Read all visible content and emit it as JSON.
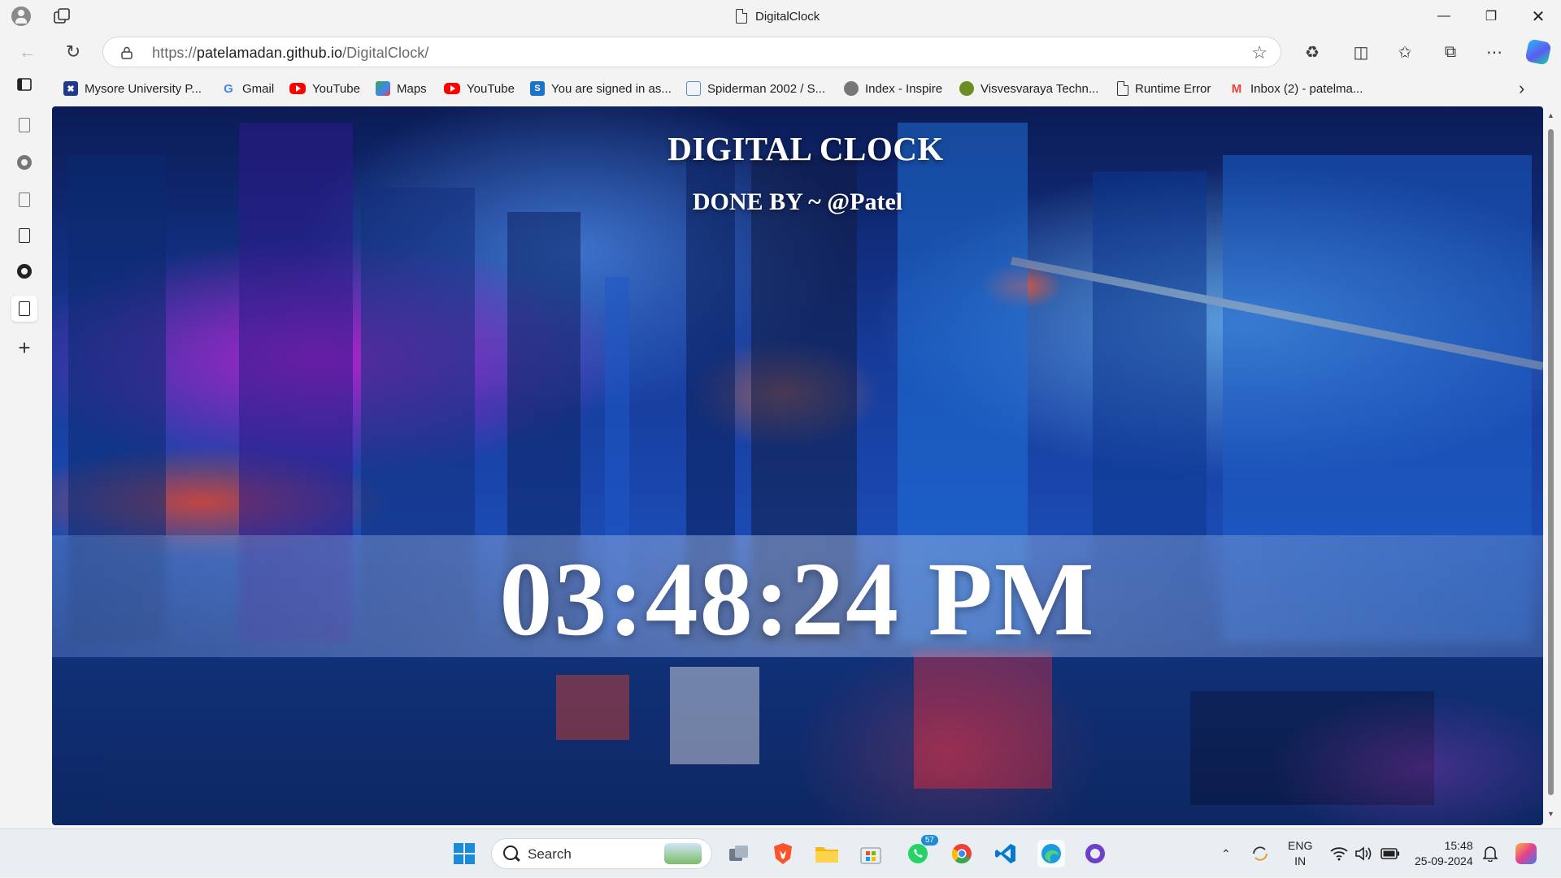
{
  "window": {
    "title": "DigitalClock",
    "controls": [
      "minimize",
      "restore",
      "close"
    ]
  },
  "addressbar": {
    "url_scheme": "https://",
    "url_host": "patelamadan.github.io",
    "url_path": "/DigitalClock/"
  },
  "favorites": [
    {
      "label": "Mysore University P...",
      "icon": "mysore-university-icon"
    },
    {
      "label": "Gmail",
      "icon": "google-icon"
    },
    {
      "label": "YouTube",
      "icon": "youtube-icon"
    },
    {
      "label": "Maps",
      "icon": "maps-icon"
    },
    {
      "label": "YouTube",
      "icon": "youtube-icon"
    },
    {
      "label": "You are signed in as...",
      "icon": "s-icon"
    },
    {
      "label": "Spiderman 2002 / S...",
      "icon": "tv-icon"
    },
    {
      "label": "Index - Inspire",
      "icon": "inspire-icon"
    },
    {
      "label": "Visvesvaraya Techn...",
      "icon": "vtu-icon"
    },
    {
      "label": "Runtime Error",
      "icon": "document-icon"
    },
    {
      "label": "Inbox (2) - patelma...",
      "icon": "gmail-icon"
    }
  ],
  "page": {
    "heading": "DIGITAL CLOCK",
    "subheading": "DONE BY ~ @Patel",
    "clock": "03:48:24 PM"
  },
  "taskbar": {
    "search_placeholder": "Search",
    "whatsapp_badge": "57",
    "lang_top": "ENG",
    "lang_bottom": "IN",
    "time": "15:48",
    "date": "25-09-2024"
  },
  "colors": {
    "accent": "#1a8bd9",
    "page_bg": "#163b9a",
    "clock_text": "#ffffff"
  }
}
